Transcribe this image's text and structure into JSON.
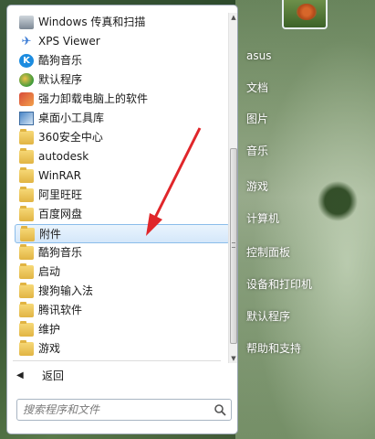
{
  "left_panel": {
    "items": [
      {
        "label": "Windows 传真和扫描",
        "icon": "scanner-icon"
      },
      {
        "label": "XPS Viewer",
        "icon": "xps-icon"
      },
      {
        "label": "酷狗音乐",
        "icon": "kugou-icon"
      },
      {
        "label": "默认程序",
        "icon": "default-programs-icon"
      },
      {
        "label": "强力卸载电脑上的软件",
        "icon": "uninstall-icon"
      },
      {
        "label": "桌面小工具库",
        "icon": "gadget-icon"
      },
      {
        "label": "360安全中心",
        "icon": "folder-icon"
      },
      {
        "label": "autodesk",
        "icon": "folder-icon"
      },
      {
        "label": "WinRAR",
        "icon": "folder-icon"
      },
      {
        "label": "阿里旺旺",
        "icon": "folder-icon"
      },
      {
        "label": "百度网盘",
        "icon": "folder-icon"
      },
      {
        "label": "附件",
        "icon": "folder-icon",
        "selected": true
      },
      {
        "label": "酷狗音乐",
        "icon": "folder-icon"
      },
      {
        "label": "启动",
        "icon": "folder-icon"
      },
      {
        "label": "搜狗输入法",
        "icon": "folder-icon"
      },
      {
        "label": "腾讯软件",
        "icon": "folder-icon"
      },
      {
        "label": "维护",
        "icon": "folder-icon"
      },
      {
        "label": "游戏",
        "icon": "folder-icon"
      }
    ],
    "back_label": "返回",
    "search_placeholder": "搜索程序和文件"
  },
  "right_pane": {
    "items": [
      "asus",
      "文档",
      "图片",
      "音乐",
      "游戏",
      "计算机",
      "控制面板",
      "设备和打印机",
      "默认程序",
      "帮助和支持"
    ]
  },
  "colors": {
    "selection_bg": "#d4e7fa",
    "selection_border": "#8bbdea",
    "annotation_arrow": "#e0262a"
  }
}
